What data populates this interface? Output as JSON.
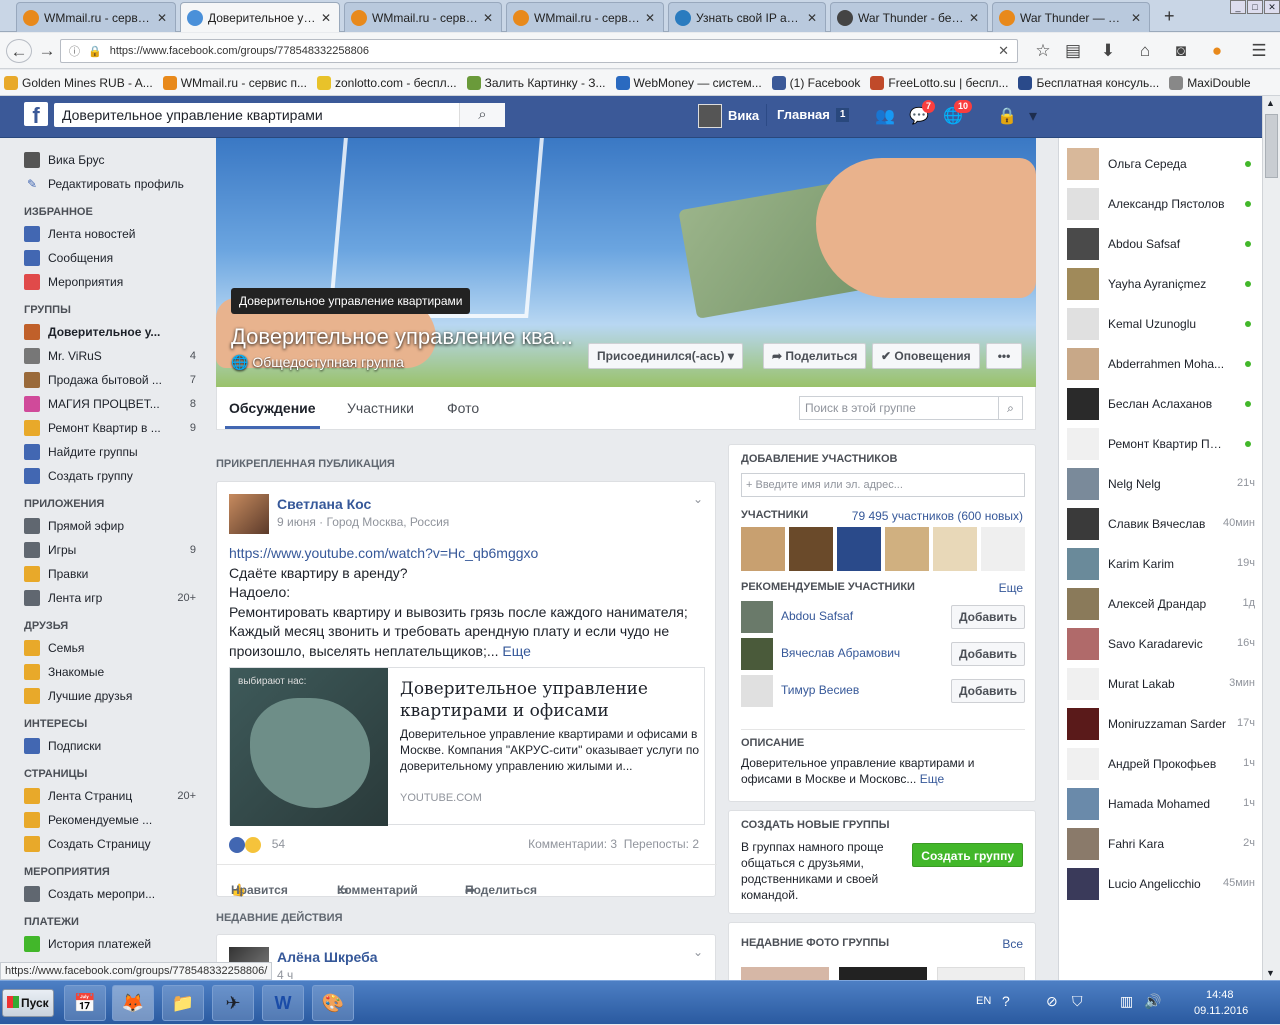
{
  "browser": {
    "tabs": [
      {
        "title": "WMmail.ru - сервис...",
        "icon_color": "#e8891b"
      },
      {
        "title": "Доверительное упр...",
        "icon_color": "#4a90d9"
      },
      {
        "title": "WMmail.ru - сервис...",
        "icon_color": "#e8891b"
      },
      {
        "title": "WMmail.ru - сервис...",
        "icon_color": "#e8891b"
      },
      {
        "title": "Узнать свой IP ад...",
        "icon_color": "#2a7bbf"
      },
      {
        "title": "War Thunder - бес...",
        "icon_color": "#444444"
      },
      {
        "title": "War Thunder — Вы...",
        "icon_color": "#e8891b"
      }
    ],
    "new_tab": "+",
    "url": "https://www.facebook.com/groups/778548332258806",
    "bookmarks": [
      "Golden Mines RUB - A...",
      "WMmail.ru - сервис п...",
      "zonlotto.com - беспл...",
      "Залить Картинку - З...",
      "WebMoney — систем...",
      "(1) Facebook",
      "FreeLotto.su | беспл...",
      "Бесплатная консуль...",
      "MaxiDouble"
    ]
  },
  "fb": {
    "logo": "f",
    "search_value": "Доверительное управление квартирами",
    "user_name": "Вика",
    "home_label": "Главная",
    "home_count": "1",
    "messages_badge": "7",
    "notifications_badge": "10"
  },
  "left": {
    "profile_name": "Вика Брус",
    "edit_profile": "Редактировать профиль",
    "sections": [
      {
        "title": "ИЗБРАННОЕ",
        "items": [
          {
            "label": "Лента новостей",
            "count": "",
            "icon": "#4267b2"
          },
          {
            "label": "Сообщения",
            "count": "",
            "icon": "#4267b2"
          },
          {
            "label": "Мероприятия",
            "count": "",
            "icon": "#e04a4a"
          }
        ]
      },
      {
        "title": "ГРУППЫ",
        "items": [
          {
            "label": "Доверительное у...",
            "count": "",
            "icon": "#c0602a"
          },
          {
            "label": "Mr. ViRuS",
            "count": "4",
            "icon": "#777777"
          },
          {
            "label": "Продажа бытовой ...",
            "count": "7",
            "icon": "#9a6a3a"
          },
          {
            "label": "МАГИЯ ПРОЦВЕТ...",
            "count": "8",
            "icon": "#d04a9a"
          },
          {
            "label": "Ремонт Квартир в ...",
            "count": "9",
            "icon": "#e8a92a"
          },
          {
            "label": "Найдите группы",
            "count": "",
            "icon": "#4267b2"
          },
          {
            "label": "Создать группу",
            "count": "",
            "icon": "#4267b2"
          }
        ]
      },
      {
        "title": "ПРИЛОЖЕНИЯ",
        "items": [
          {
            "label": "Прямой эфир",
            "count": "",
            "icon": "#606770"
          },
          {
            "label": "Игры",
            "count": "9",
            "icon": "#606770"
          },
          {
            "label": "Правки",
            "count": "",
            "icon": "#e8a92a"
          },
          {
            "label": "Лента игр",
            "count": "20+",
            "icon": "#606770"
          }
        ]
      },
      {
        "title": "ДРУЗЬЯ",
        "items": [
          {
            "label": "Семья",
            "count": "",
            "icon": "#e8a92a"
          },
          {
            "label": "Знакомые",
            "count": "",
            "icon": "#e8a92a"
          },
          {
            "label": "Лучшие друзья",
            "count": "",
            "icon": "#e8a92a"
          }
        ]
      },
      {
        "title": "ИНТЕРЕСЫ",
        "items": [
          {
            "label": "Подписки",
            "count": "",
            "icon": "#4267b2"
          }
        ]
      },
      {
        "title": "СТРАНИЦЫ",
        "items": [
          {
            "label": "Лента Страниц",
            "count": "20+",
            "icon": "#e8a92a"
          },
          {
            "label": "Рекомендуемые ...",
            "count": "",
            "icon": "#e8a92a"
          },
          {
            "label": "Создать Страницу",
            "count": "",
            "icon": "#e8a92a"
          }
        ]
      },
      {
        "title": "МЕРОПРИЯТИЯ",
        "items": [
          {
            "label": "Создать меропри...",
            "count": "",
            "icon": "#606770"
          }
        ]
      },
      {
        "title": "ПЛАТЕЖИ",
        "items": [
          {
            "label": "История платежей",
            "count": "",
            "icon": "#42b72a"
          }
        ]
      }
    ]
  },
  "group": {
    "tooltip": "Доверительное управление квартирами",
    "name": "Доверительное управление ква...",
    "type": "Общедоступная группа",
    "joined_button": "Присоединился(-ась) ▾",
    "share_button": "Поделиться",
    "notify_button": "✔ Оповещения",
    "more_button": "•••",
    "tabs": [
      "Обсуждение",
      "Участники",
      "Фото"
    ],
    "search_placeholder": "Поиск в этой группе"
  },
  "feed": {
    "pinned_label": "ПРИКРЕПЛЕННАЯ ПУБЛИКАЦИЯ",
    "recent_label": "НЕДАВНИЕ ДЕЙСТВИЯ",
    "post": {
      "author": "Светлана Кос",
      "meta": "9 июня · Город Москва, Россия",
      "link": "https://www.youtube.com/watch?v=Hc_qb6mggxo",
      "lines": [
        "Сдаёте квартиру в аренду?",
        "Надоело:",
        "Ремонтировать квартиру и вывозить грязь после каждого нанимателя;",
        "Каждый месяц звонить и требовать арендную плату и если чудо не",
        "произошло, выселять неплательщиков;..."
      ],
      "more": "Еще",
      "preview": {
        "image_text": "выбирают нас:",
        "title": "Доверительное управление квартирами и офисами",
        "desc": "Доверительное управление квартирами и офисами в Москве. Компания \"АКРУС-сити\" оказывает услуги по доверительному управлению жилыми и...",
        "source": "YOUTUBE.COM"
      },
      "reactions_count": "54",
      "comments": "Комментарии: 3",
      "shares": "Перепосты: 2",
      "like": "Нравится",
      "comment": "Комментарий",
      "share": "Поделиться"
    },
    "next_post": {
      "author": "Алёна Шкреба",
      "meta": "4 ч"
    }
  },
  "sidebar": {
    "add_members_title": "ДОБАВЛЕНИЕ УЧАСТНИКОВ",
    "add_placeholder": "Введите имя или эл. адрес...",
    "members_label": "УЧАСТНИКИ",
    "members_count": "79 495 участников (600 новых)",
    "member_colors": [
      "#c8a070",
      "#6a4a2a",
      "#2a4a8a",
      "#d0b080",
      "#e8d8b8",
      "#efefef"
    ],
    "suggested_title": "РЕКОМЕНДУЕМЫЕ УЧАСТНИКИ",
    "suggested_more": "Еще",
    "suggested": [
      {
        "name": "Abdou Safsaf",
        "button": "Добавить"
      },
      {
        "name": "Вячеслав Абрамович",
        "button": "Добавить"
      },
      {
        "name": "Тимур Весиев",
        "button": "Добавить"
      }
    ],
    "description_title": "ОПИСАНИЕ",
    "description": "Доверительное управление квартирами и офисами в Москве и Московс...",
    "description_more": "Еще",
    "create_title": "СОЗДАТЬ НОВЫЕ ГРУППЫ",
    "create_text": "В группах намного проще общаться с друзьями, родственниками и своей командой.",
    "create_button": "Создать группу",
    "photos_title": "НЕДАВНИЕ ФОТО ГРУППЫ",
    "photos_all": "Все"
  },
  "chat": [
    {
      "name": "Ольга Середа",
      "status": "",
      "online": true
    },
    {
      "name": "Александр Пястолов",
      "status": "",
      "online": true
    },
    {
      "name": "Abdou Safsaf",
      "status": "",
      "online": true
    },
    {
      "name": "Yayha Ayraniçmez",
      "status": "",
      "online": true
    },
    {
      "name": "Kemal Uzunoglu",
      "status": "",
      "online": true
    },
    {
      "name": "Abderrahmen Moha...",
      "status": "",
      "online": true
    },
    {
      "name": "Беслан Аслаханов",
      "status": "",
      "online": true
    },
    {
      "name": "Ремонт Квартир При...",
      "status": "",
      "online": true
    },
    {
      "name": "Nelg Nelg",
      "status": "21ч",
      "online": false
    },
    {
      "name": "Славик Вячеслав",
      "status": "40мин",
      "online": false
    },
    {
      "name": "Karim Karim",
      "status": "19ч",
      "online": false
    },
    {
      "name": "Алексей Драндар",
      "status": "1д",
      "online": false
    },
    {
      "name": "Savo Karadarevic",
      "status": "16ч",
      "online": false
    },
    {
      "name": "Murat Lakab",
      "status": "3мин",
      "online": false
    },
    {
      "name": "Moniruzzaman Sarder",
      "status": "17ч",
      "online": false
    },
    {
      "name": "Андрей Прокофьев",
      "status": "1ч",
      "online": false
    },
    {
      "name": "Hamada Mohamed",
      "status": "1ч",
      "online": false
    },
    {
      "name": "Fahri Kara",
      "status": "2ч",
      "online": false
    },
    {
      "name": "Lucio Angelicchio",
      "status": "45мин",
      "online": false
    }
  ],
  "status_url": "https://www.facebook.com/groups/778548332258806/",
  "taskbar": {
    "start": "Пуск",
    "lang": "EN",
    "time": "14:48",
    "date": "09.11.2016"
  }
}
